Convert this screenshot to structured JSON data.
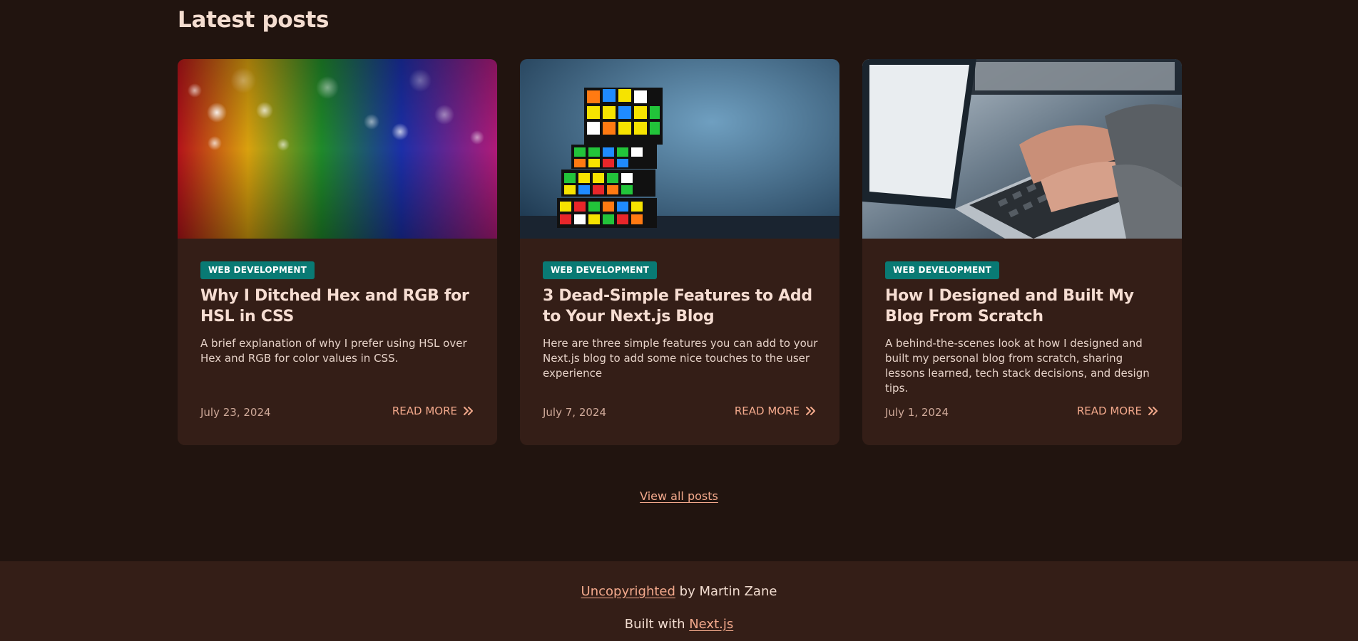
{
  "section": {
    "title": "Latest posts"
  },
  "posts": [
    {
      "category": "WEB DEVELOPMENT",
      "title": "Why I Ditched Hex and RGB for HSL in CSS",
      "description": "A brief explanation of why I prefer using HSL over Hex and RGB for color values in CSS.",
      "date": "July 23, 2024",
      "read_more": "READ MORE",
      "image_icon": "rainbow-glitter-image"
    },
    {
      "category": "WEB DEVELOPMENT",
      "title": "3 Dead-Simple Features to Add to Your Next.js Blog",
      "description": "Here are three simple features you can add to your Next.js blog to add some nice touches to the user experience",
      "date": "July 7, 2024",
      "read_more": "READ MORE",
      "image_icon": "rubiks-cube-image"
    },
    {
      "category": "WEB DEVELOPMENT",
      "title": "How I Designed and Built My Blog From Scratch",
      "description": "A behind-the-scenes look at how I designed and built my personal blog from scratch, sharing lessons learned, tech stack decisions, and design tips.",
      "date": "July 1, 2024",
      "read_more": "READ MORE",
      "image_icon": "laptop-typing-image"
    }
  ],
  "view_all": "View all posts",
  "footer": {
    "copyright_link": "Uncopyrighted",
    "copyright_suffix": " by Martin Zane",
    "built_prefix": "Built with ",
    "built_link": "Next.js"
  },
  "colors": {
    "background": "#21140f",
    "card": "#341e17",
    "badge": "#097a74",
    "accent": "#f3a98c",
    "text": "#f1dcd0"
  }
}
